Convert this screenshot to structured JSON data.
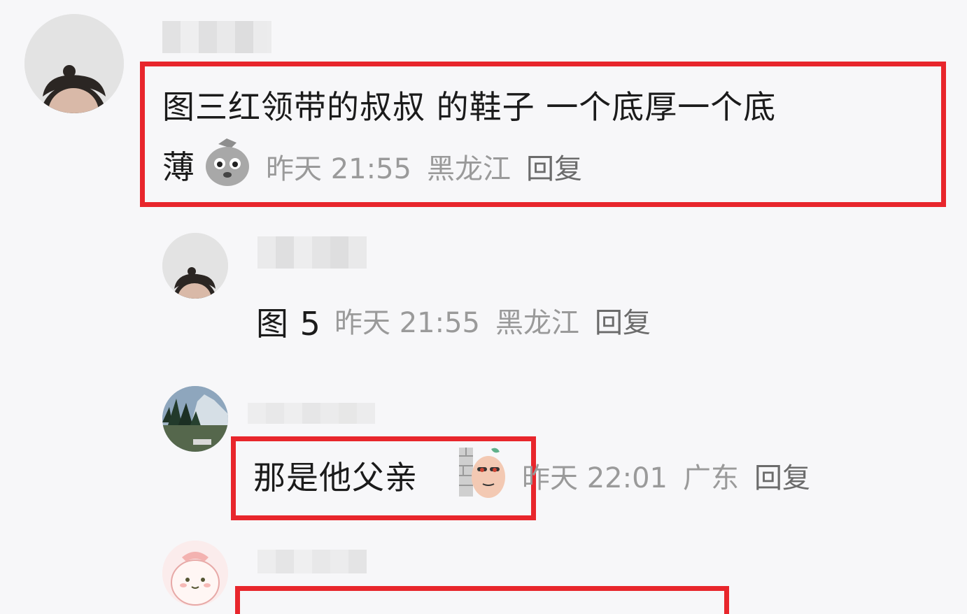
{
  "comments": [
    {
      "text_line1": "图三红领带的叔叔 的鞋子 一个底厚一个底",
      "text_line2": "薄",
      "time": "昨天 21:55",
      "location": "黑龙江",
      "reply_label": "回复",
      "sticker_icon": "surprised-bag-emoji-icon"
    },
    {
      "text": "图 5",
      "time": "昨天 21:55",
      "location": "黑龙江",
      "reply_label": "回复"
    },
    {
      "text": "那是他父亲",
      "time": "昨天 22:01",
      "location": "广东",
      "reply_label": "回复",
      "sticker_icon": "peeking-behind-wall-emoji-icon"
    }
  ],
  "colors": {
    "highlight": "#e8262c",
    "meta_text": "#9a9a9a",
    "body_text": "#1b1b1b"
  }
}
